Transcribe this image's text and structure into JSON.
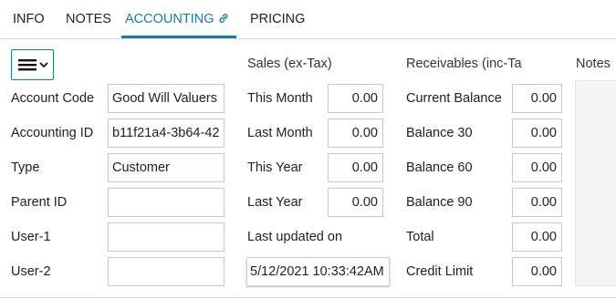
{
  "tabs": {
    "info": "INFO",
    "notes": "NOTES",
    "accounting": "ACCOUNTING",
    "pricing": "PRICING",
    "accounting_icon": "link-icon"
  },
  "colors": {
    "accent": "#1f7a9c",
    "border": "#c8c8c8"
  },
  "left": {
    "account_code_label": "Account Code",
    "account_code_value": "Good Will Valuers",
    "accounting_id_label": "Accounting ID",
    "accounting_id_value": "b11f21a4-3b64-42",
    "type_label": "Type",
    "type_value": "Customer",
    "parent_id_label": "Parent ID",
    "parent_id_value": "",
    "user1_label": "User-1",
    "user1_value": "",
    "user2_label": "User-2",
    "user2_value": ""
  },
  "sales": {
    "header": "Sales (ex-Tax)",
    "this_month_label": "This Month",
    "this_month_value": "0.00",
    "last_month_label": "Last Month",
    "last_month_value": "0.00",
    "this_year_label": "This Year",
    "this_year_value": "0.00",
    "last_year_label": "Last Year",
    "last_year_value": "0.00",
    "last_updated_label": "Last updated on",
    "last_updated_value": "5/12/2021 10:33:42AM"
  },
  "receivables": {
    "header": "Receivables (inc-Ta",
    "current_balance_label": "Current Balance",
    "current_balance_value": "0.00",
    "balance30_label": "Balance 30",
    "balance30_value": "0.00",
    "balance60_label": "Balance 60",
    "balance60_value": "0.00",
    "balance90_label": "Balance 90",
    "balance90_value": "0.00",
    "total_label": "Total",
    "total_value": "0.00",
    "credit_limit_label": "Credit Limit",
    "credit_limit_value": "0.00"
  },
  "notes": {
    "header": "Notes"
  }
}
